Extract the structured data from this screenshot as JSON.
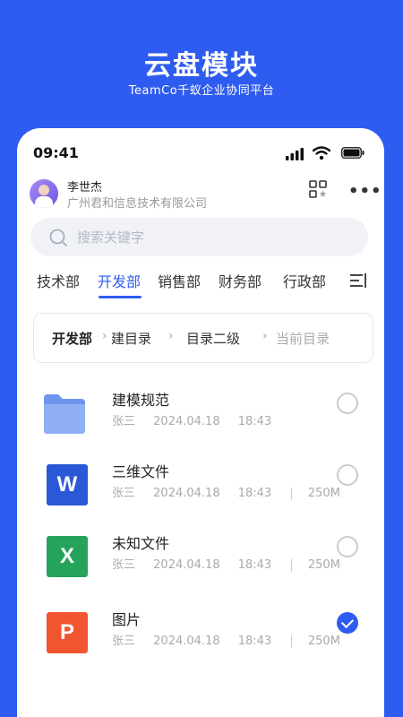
{
  "promo": {
    "title": "云盘模块",
    "subtitle": "TeamCo千蚁企业协同平台"
  },
  "status_bar": {
    "time": "09:41",
    "icons": [
      "signal-icon",
      "wifi-icon",
      "battery-icon"
    ]
  },
  "user": {
    "name": "李世杰",
    "company": "广州君和信息技术有限公司",
    "actions": [
      "qr-code-icon",
      "more-icon"
    ],
    "more_label": "•••"
  },
  "search": {
    "placeholder": "搜索关键字"
  },
  "tabs": [
    {
      "label": "技术部",
      "active": false
    },
    {
      "label": "开发部",
      "active": true
    },
    {
      "label": "销售部",
      "active": false
    },
    {
      "label": "财务部",
      "active": false
    },
    {
      "label": "行政部",
      "active": false
    }
  ],
  "breadcrumb": {
    "items": [
      "开发部",
      "建目录",
      "目录二级",
      "当前目录"
    ]
  },
  "files": [
    {
      "name": "建模规范",
      "type": "folder",
      "owner": "张三",
      "date": "2024.04.18",
      "time": "18:43",
      "size": "",
      "checked": false
    },
    {
      "name": "三维文件",
      "type": "word",
      "icon_letter": "W",
      "owner": "张三",
      "date": "2024.04.18",
      "time": "18:43",
      "size": "250M",
      "checked": false
    },
    {
      "name": "未知文件",
      "type": "excel",
      "icon_letter": "X",
      "owner": "张三",
      "date": "2024.04.18",
      "time": "18:43",
      "size": "250M",
      "checked": false
    },
    {
      "name": "图片",
      "type": "powerpoint",
      "icon_letter": "P",
      "owner": "张三",
      "date": "2024.04.18",
      "time": "18:43",
      "size": "250M",
      "checked": true
    }
  ],
  "colors": {
    "brand": "#2f5cf0",
    "word": "#2b58d6",
    "excel": "#26a35a",
    "powerpoint": "#f0552f",
    "folder": "#7aa2f2"
  }
}
